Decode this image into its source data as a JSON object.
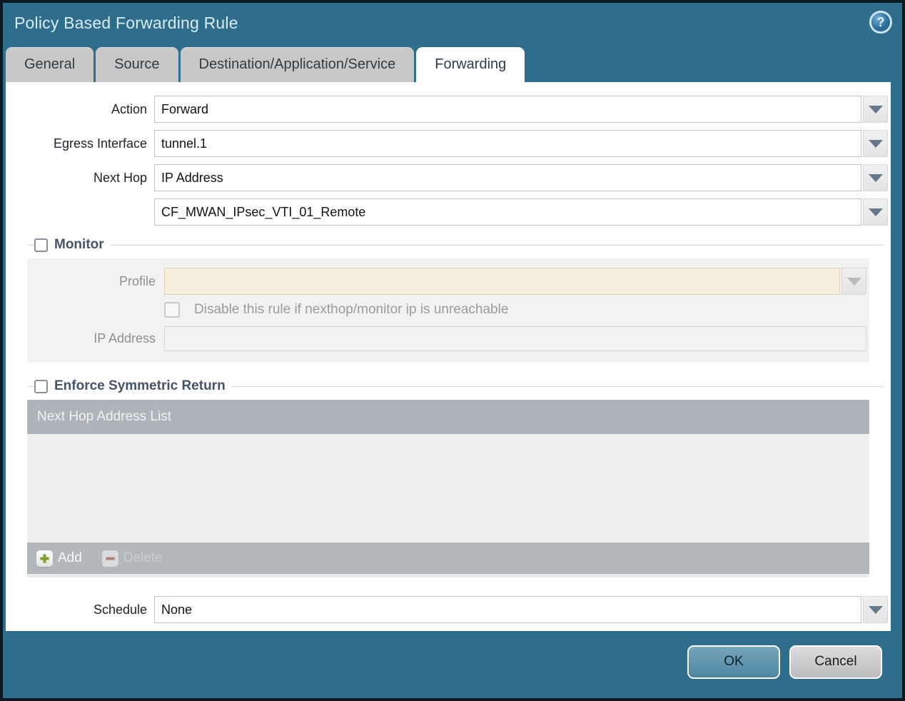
{
  "window": {
    "title": "Policy Based Forwarding Rule"
  },
  "colors": {
    "titlebar_teal": "#2e6d8b",
    "frame_border": "#0c1822",
    "inactive_tab_bg": "#c8c8c9",
    "active_tab_bg": "#ffffff",
    "fieldset_label": "#44546a",
    "disabled_profile_bg": "#f5eedc",
    "table_header_bg": "#aeb5ba",
    "add_icon_green": "#7fa12f",
    "delete_icon_red": "#b08177",
    "ok_button_bg": "#5e93ae",
    "cancel_button_bg": "#c9c9cc"
  },
  "icons": {
    "help": "question-mark-circle",
    "dropdown": "chevron-down-triangle",
    "add": "green-plus",
    "delete": "red-minus"
  },
  "tabs": [
    {
      "label": "General",
      "active": false
    },
    {
      "label": "Source",
      "active": false
    },
    {
      "label": "Destination/Application/Service",
      "active": false
    },
    {
      "label": "Forwarding",
      "active": true
    }
  ],
  "form": {
    "action": {
      "label": "Action",
      "value": "Forward"
    },
    "egress_interface": {
      "label": "Egress Interface",
      "value": "tunnel.1"
    },
    "next_hop": {
      "label": "Next Hop",
      "value": "IP Address"
    },
    "next_hop_address": {
      "value": "CF_MWAN_IPsec_VTI_01_Remote"
    },
    "schedule": {
      "label": "Schedule",
      "value": "None"
    }
  },
  "monitor": {
    "title": "Monitor",
    "checked": false,
    "profile": {
      "label": "Profile",
      "value": ""
    },
    "disable_rule": {
      "label": "Disable this rule if nexthop/monitor ip is unreachable",
      "checked": false
    },
    "ip_address": {
      "label": "IP Address",
      "value": ""
    }
  },
  "symmetric_return": {
    "title": "Enforce Symmetric Return",
    "checked": false,
    "table": {
      "header": "Next Hop Address List",
      "rows": []
    },
    "buttons": {
      "add": "Add",
      "delete": "Delete"
    }
  },
  "dialog_buttons": {
    "ok": "OK",
    "cancel": "Cancel"
  }
}
